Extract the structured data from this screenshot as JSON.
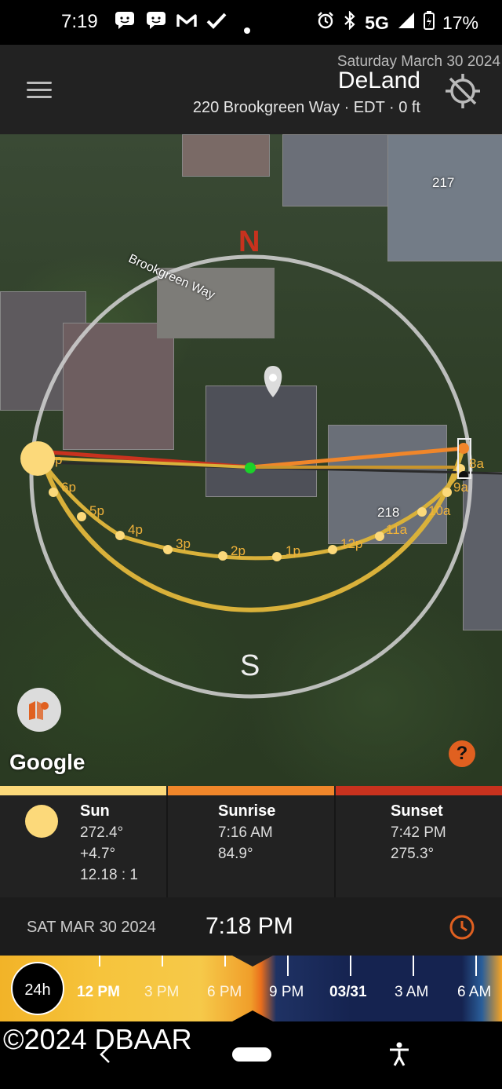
{
  "status_bar": {
    "time": "7:19",
    "network": "5G",
    "battery": "17%",
    "icons": [
      "chat-icon",
      "chat-icon",
      "gmail-icon",
      "check-icon",
      "dot-icon",
      "alarm-icon",
      "bluetooth-icon",
      "signal-icon",
      "battery-icon"
    ]
  },
  "header": {
    "date": "Saturday March 30 2024",
    "city": "DeLand",
    "address_line": "220 Brookgreen Way  ·  EDT  ·  0 ft",
    "menu_icon": "hamburger-icon",
    "location_icon": "gps-off-icon"
  },
  "map": {
    "street_label": "Brookgreen Way",
    "house_labels": [
      "217",
      "218"
    ],
    "north_label": "N",
    "south_label": "S",
    "hour_labels": [
      "p",
      "6p",
      "5p",
      "4p",
      "3p",
      "2p",
      "1p",
      "12p",
      "11a",
      "10a",
      "9a",
      "8a"
    ],
    "google_label": "Google",
    "help_label": "?",
    "colors": {
      "sun": "#fcd97a",
      "sun_path": "#d9b13a",
      "sunrise": "#f0862a",
      "sunset": "#c8321e"
    }
  },
  "panels": {
    "sun": {
      "title": "Sun",
      "azimuth": "272.4°",
      "elevation": "+4.7°",
      "ratio": "12.18 : 1"
    },
    "sunrise": {
      "title": "Sunrise",
      "time": "7:16 AM",
      "azimuth": "84.9°"
    },
    "sunset": {
      "title": "Sunset",
      "time": "7:42 PM",
      "azimuth": "275.3°"
    }
  },
  "timebar": {
    "date": "SAT MAR 30 2024",
    "time": "7:18 PM",
    "badge": "24h",
    "labels": [
      "12 PM",
      "3 PM",
      "6 PM",
      "9 PM",
      "03/31",
      "3 AM",
      "6 AM"
    ]
  },
  "nav": {
    "copyright": "©2024 DBAAR"
  }
}
